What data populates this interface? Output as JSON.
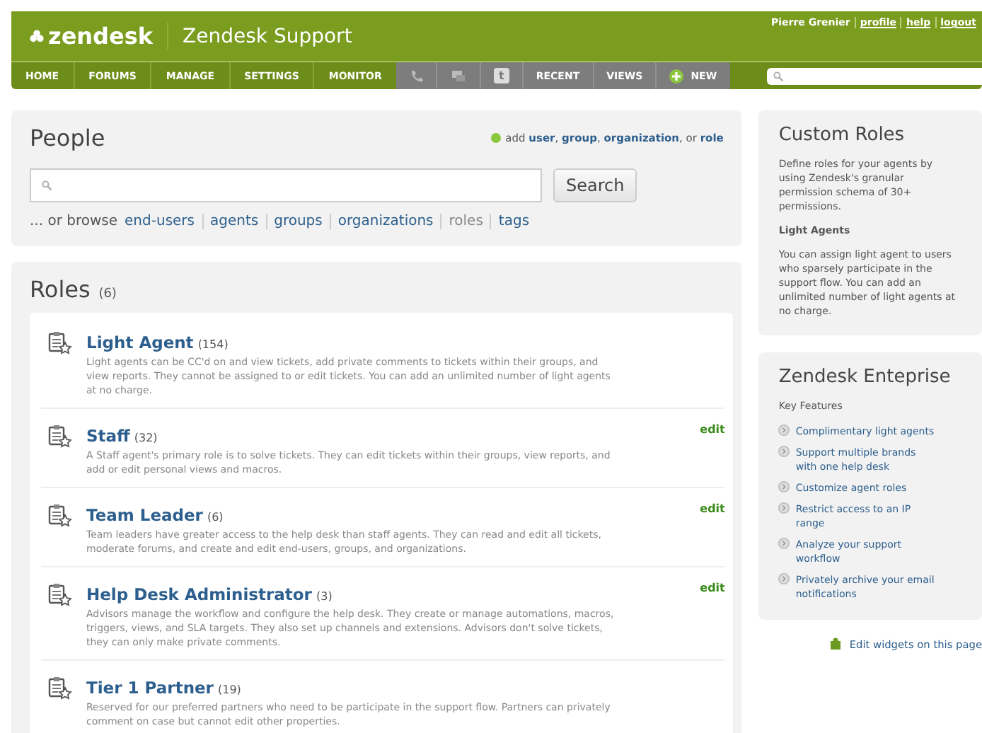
{
  "header": {
    "logo": "zendesk",
    "title": "Zendesk Support",
    "user": "Pierre Grenier",
    "user_links": [
      "profile",
      "help",
      "logout"
    ]
  },
  "nav": {
    "items": [
      {
        "label": "HOME"
      },
      {
        "label": "FORUMS"
      },
      {
        "label": "MANAGE"
      },
      {
        "label": "SETTINGS"
      },
      {
        "label": "MONITOR"
      }
    ],
    "tools": [
      {
        "kind": "phone"
      },
      {
        "kind": "chat"
      },
      {
        "kind": "twitter",
        "label": "t"
      },
      {
        "kind": "text",
        "label": "RECENT"
      },
      {
        "kind": "text",
        "label": "VIEWS"
      },
      {
        "kind": "new",
        "label": "NEW"
      }
    ]
  },
  "people": {
    "title": "People",
    "add_prefix": "add",
    "add_links": [
      {
        "label": "user",
        "suffix": ","
      },
      {
        "label": "group",
        "suffix": ","
      },
      {
        "label": "organization",
        "suffix": ", or"
      },
      {
        "label": "role"
      }
    ],
    "search_button": "Search",
    "browse_prefix": "... or browse",
    "browse": [
      {
        "label": "end-users",
        "selected": false
      },
      {
        "label": "agents",
        "selected": false
      },
      {
        "label": "groups",
        "selected": false
      },
      {
        "label": "organizations",
        "selected": false
      },
      {
        "label": "roles",
        "selected": true
      },
      {
        "label": "tags",
        "selected": false
      }
    ]
  },
  "roles": {
    "title": "Roles",
    "count": "(6)",
    "items": [
      {
        "name": "Light Agent",
        "count": "(154)",
        "description": "Light agents can be CC'd on and view tickets, add private comments to tickets within their groups, and view reports. They cannot be assigned to or edit tickets. You can add an unlimited number of light agents at no charge."
      },
      {
        "name": "Staff",
        "count": "(32)",
        "description": "A Staff agent's primary role is to solve tickets. They can edit tickets within their groups, view reports, and add or edit personal views and macros.",
        "edit": "edit"
      },
      {
        "name": "Team Leader",
        "count": "(6)",
        "description": "Team leaders have greater access to the help desk than staff agents. They can read and edit all tickets, moderate forums, and create and edit end-users, groups, and organizations.",
        "edit": "edit"
      },
      {
        "name": "Help Desk Administrator",
        "count": "(3)",
        "description": "Advisors manage the workflow and configure the help desk. They create or manage automations, macros, triggers, views, and SLA targets. They also set up channels and extensions. Advisors don't solve tickets, they can only make private comments.",
        "edit": "edit"
      },
      {
        "name": "Tier 1 Partner",
        "count": "(19)",
        "description": "Reserved for our preferred partners who need to be participate in the support flow. Partners can privately comment on case but cannot edit other properties."
      }
    ]
  },
  "custom_roles": {
    "title": "Custom Roles",
    "text": "Define roles for your agents by using Zendesk's granular permission schema of 30+ permissions.",
    "subtitle": "Light Agents",
    "subtext": "You can assign light agent to users who sparsely participate in the support flow. You can add an unlimited number of light agents at no charge."
  },
  "enterprise": {
    "title": "Zendesk Enteprise",
    "subtitle": "Key Features",
    "features": [
      "Complimentary light agents",
      "Support multiple brands with one help desk",
      "Customize agent roles",
      "Restrict access to an IP range",
      "Analyze your support workflow",
      "Privately archive your email notifications"
    ]
  },
  "edit_widgets": "Edit widgets on this page"
}
